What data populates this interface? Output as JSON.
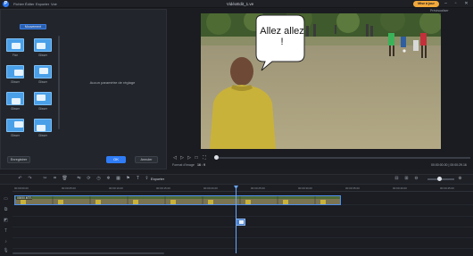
{
  "titlebar": {
    "logo": "P",
    "menu": [
      "Fichier",
      "Éditer",
      "Exporter",
      "Voir"
    ],
    "document_title": "VidéoEdit_1.ve",
    "upgrade_label": "Mise à jour"
  },
  "left_panel": {
    "mode_button": "Mouvement",
    "overlay_tiles": [
      {
        "label": "Fixe"
      },
      {
        "label": "Glisser"
      },
      {
        "label": "Glisser"
      },
      {
        "label": "Glisser"
      },
      {
        "label": "Glisser"
      },
      {
        "label": "Glisser"
      },
      {
        "label": "Glisser"
      },
      {
        "label": "Glisser"
      }
    ],
    "empty_message": "Aucun paramètre de réglage",
    "save_button": "Enregistrer",
    "ok_button": "OK",
    "cancel_button": "Annuler"
  },
  "preview": {
    "quality_label": "Prévisualiser",
    "speech_bubble_text": "Allez allez !",
    "aspect_label": "Format d'image",
    "aspect_value": "16 : 9",
    "time_readout": "00:00:00.00 | 00:00:29.16",
    "current_fraction": 0.0
  },
  "toolbar": {
    "export_label": "Exporter",
    "icons": [
      "undo-icon",
      "redo-icon",
      "split-icon",
      "crop-icon",
      "delete-icon",
      "mirror-icon",
      "rotate-icon",
      "speed-icon",
      "freeze-icon",
      "mosaic-icon",
      "marker-icon",
      "audio-icon",
      "text-icon"
    ]
  },
  "timeline": {
    "ruler_labels": [
      "00:00:00.00",
      "00:00:05.00",
      "00:00:10.00",
      "00:00:15.00",
      "00:00:20.00",
      "00:00:25.00",
      "00:00:30.00",
      "00:00:35.00",
      "00:00:40.00",
      "00:00:45.00"
    ],
    "video_clip_name": "00000.MTS"
  }
}
